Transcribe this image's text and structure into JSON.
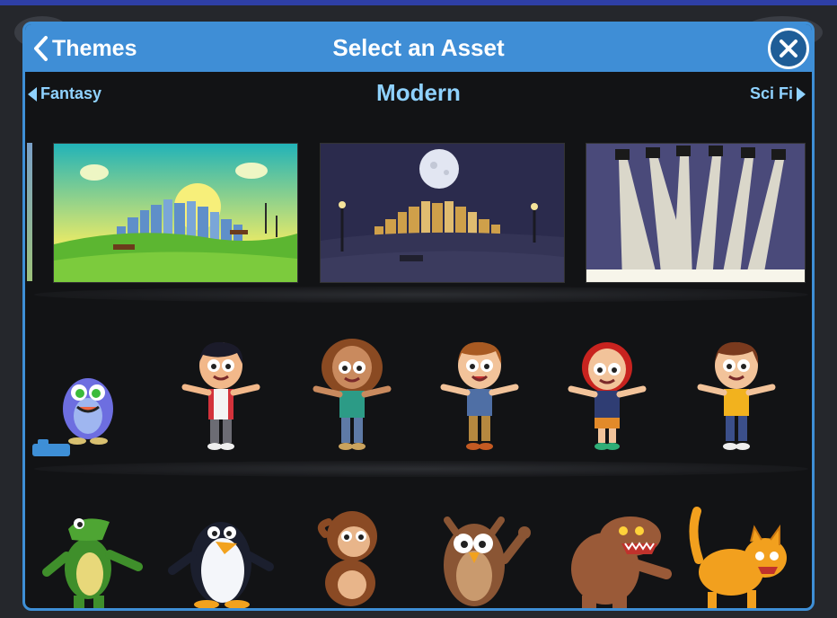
{
  "header": {
    "back_label": "Themes",
    "title": "Select an Asset",
    "close_icon": "close-icon"
  },
  "theme_nav": {
    "previous": "Fantasy",
    "current": "Modern",
    "next": "Sci Fi"
  },
  "backgrounds": [
    {
      "name": "day-city-park"
    },
    {
      "name": "night-city-park"
    },
    {
      "name": "stage-spotlights"
    }
  ],
  "characters_row1": [
    {
      "name": "blue-monster"
    },
    {
      "name": "boy-black-hair"
    },
    {
      "name": "girl-curly-hair"
    },
    {
      "name": "boy-brown-hair"
    },
    {
      "name": "girl-red-hair"
    },
    {
      "name": "boy-yellow-shirt"
    }
  ],
  "characters_row2": [
    {
      "name": "crocodile"
    },
    {
      "name": "penguin"
    },
    {
      "name": "monkey"
    },
    {
      "name": "owl"
    },
    {
      "name": "werewolf"
    },
    {
      "name": "angry-cat"
    }
  ],
  "colors": {
    "header_blue": "#3f8ed6",
    "nav_text": "#8fd2ff",
    "modal_bg": "#121315"
  }
}
